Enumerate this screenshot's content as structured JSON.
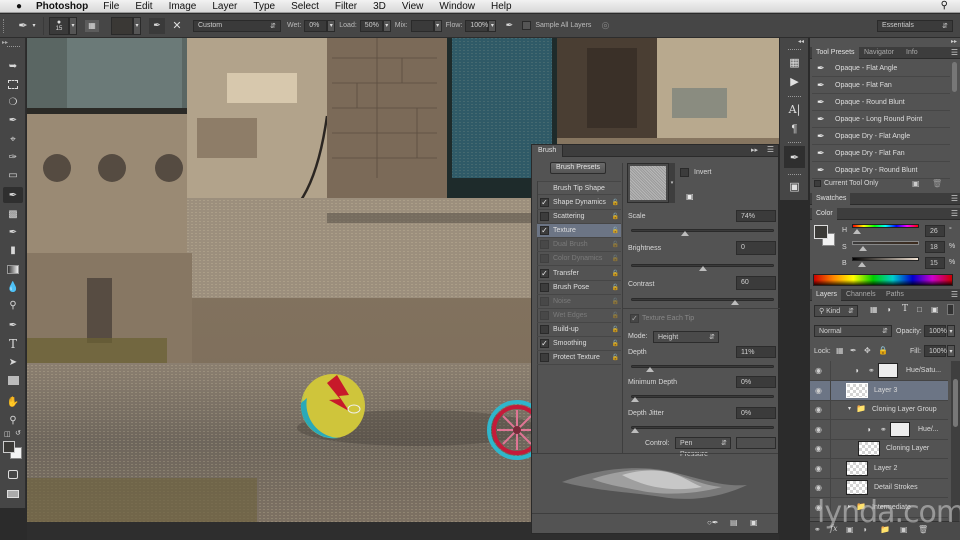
{
  "menubar": {
    "apple_icon": "apple-logo",
    "app_name": "Photoshop",
    "items": [
      "File",
      "Edit",
      "Image",
      "Layer",
      "Type",
      "Select",
      "Filter",
      "3D",
      "View",
      "Window",
      "Help"
    ],
    "search_icon": "⌕"
  },
  "options": {
    "brush_size": "15",
    "preset_mode": "Custom",
    "wet_label": "Wet:",
    "wet_value": "0%",
    "load_label": "Load:",
    "load_value": "50%",
    "mix_label": "Mix:",
    "mix_value": "",
    "flow_label": "Flow:",
    "flow_value": "100%",
    "sample_all_layers": "Sample All Layers",
    "workspace": "Essentials"
  },
  "brush_panel": {
    "tab": "Brush",
    "presets_button": "Brush Presets",
    "tip_shape": "Brush Tip Shape",
    "options": [
      {
        "label": "Shape Dynamics",
        "checked": true,
        "enabled": true,
        "selected": false
      },
      {
        "label": "Scattering",
        "checked": false,
        "enabled": true,
        "selected": false
      },
      {
        "label": "Texture",
        "checked": true,
        "enabled": true,
        "selected": true
      },
      {
        "label": "Dual Brush",
        "checked": false,
        "enabled": false,
        "selected": false
      },
      {
        "label": "Color Dynamics",
        "checked": false,
        "enabled": false,
        "selected": false
      },
      {
        "label": "Transfer",
        "checked": true,
        "enabled": true,
        "selected": false
      },
      {
        "label": "Brush Pose",
        "checked": false,
        "enabled": true,
        "selected": false
      },
      {
        "label": "Noise",
        "checked": false,
        "enabled": false,
        "selected": false
      },
      {
        "label": "Wet Edges",
        "checked": false,
        "enabled": false,
        "selected": false
      },
      {
        "label": "Build-up",
        "checked": false,
        "enabled": true,
        "selected": false
      },
      {
        "label": "Smoothing",
        "checked": true,
        "enabled": true,
        "selected": false
      },
      {
        "label": "Protect Texture",
        "checked": false,
        "enabled": true,
        "selected": false
      }
    ],
    "invert_label": "Invert",
    "scale": {
      "label": "Scale",
      "value": "74%",
      "fraction": 0.37
    },
    "brightness": {
      "label": "Brightness",
      "value": "0",
      "fraction": 0.5
    },
    "contrast": {
      "label": "Contrast",
      "value": "60",
      "fraction": 0.74
    },
    "texture_each_tip": "Texture Each Tip",
    "mode_label": "Mode:",
    "mode_value": "Height",
    "depth": {
      "label": "Depth",
      "value": "11%",
      "fraction": 0.11
    },
    "min_depth": {
      "label": "Minimum Depth",
      "value": "0%",
      "fraction": 0
    },
    "depth_jitter": {
      "label": "Depth Jitter",
      "value": "0%",
      "fraction": 0
    },
    "control_label": "Control:",
    "control_value": "Pen Pressure"
  },
  "tool_presets": {
    "tabs": [
      "Tool Presets",
      "Navigator",
      "Info"
    ],
    "items": [
      "Opaque - Flat Angle",
      "Opaque - Flat Fan",
      "Opaque - Round Blunt",
      "Opaque - Long Round Point",
      "Opaque Dry -  Flat Angle",
      "Opaque Dry - Flat Fan",
      "Opaque Dry - Round Blunt"
    ],
    "current_tool_only": "Current Tool Only"
  },
  "swatches_tab": "Swatches",
  "color": {
    "tab": "Color",
    "h_label": "H",
    "h_value": "26",
    "h_unit": "°",
    "s_label": "S",
    "s_value": "18",
    "s_unit": "%",
    "b_label": "B",
    "b_value": "15",
    "b_unit": "%",
    "foreground": "#3b3a37",
    "background": "#f2f2f2"
  },
  "layers": {
    "tabs": [
      "Layers",
      "Channels",
      "Paths"
    ],
    "filter_kind": "Kind",
    "blend_mode": "Normal",
    "opacity_label": "Opacity:",
    "opacity_value": "100%",
    "lock_label": "Lock:",
    "fill_label": "Fill:",
    "fill_value": "100%",
    "items": [
      {
        "name": "Hue/Satu...",
        "type": "adjustment",
        "selected": false
      },
      {
        "name": "Layer 3",
        "type": "pixel",
        "selected": true
      },
      {
        "name": "Cloning Layer Group",
        "type": "group",
        "selected": false
      },
      {
        "name": "Hue/...",
        "type": "adjustment",
        "selected": false
      },
      {
        "name": "Cloning Layer",
        "type": "pixel",
        "selected": false
      },
      {
        "name": "Layer 2",
        "type": "pixel",
        "selected": false
      },
      {
        "name": "Detail Strokes",
        "type": "pixel",
        "selected": false
      },
      {
        "name": "Intermediate",
        "type": "group",
        "selected": false
      }
    ]
  },
  "watermark": "lynda.com"
}
